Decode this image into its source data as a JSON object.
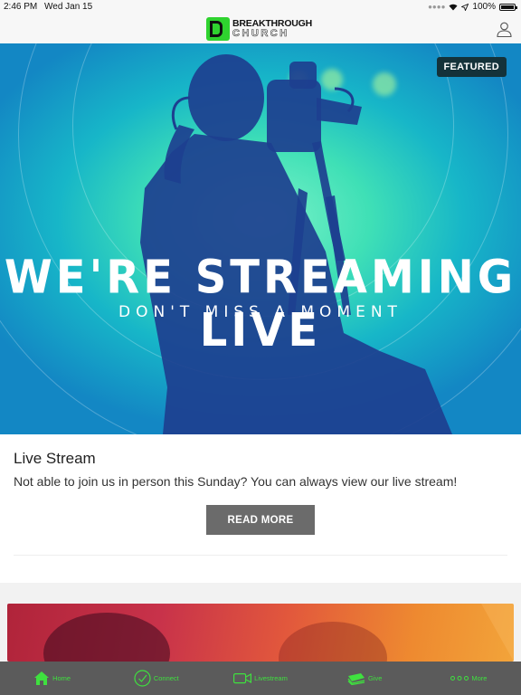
{
  "status": {
    "time": "2:46 PM",
    "date": "Wed Jan 15",
    "battery": "100%"
  },
  "brand": {
    "line1": "BREAKTHROUGH",
    "line2": "CHURCH"
  },
  "hero": {
    "badge": "FEATURED",
    "headline": "WE'RE STREAMING LIVE",
    "subheadline": "DON'T MISS A MOMENT"
  },
  "card": {
    "title": "Live Stream",
    "description": "Not able to join us in person this Sunday? You can always view our live stream!",
    "button_label": "READ MORE"
  },
  "tabs": [
    {
      "label": "Home",
      "icon": "home-icon"
    },
    {
      "label": "Connect",
      "icon": "check-circle-icon"
    },
    {
      "label": "Livestream",
      "icon": "video-camera-icon"
    },
    {
      "label": "Give",
      "icon": "money-icon"
    },
    {
      "label": "More",
      "icon": "more-dots-icon"
    }
  ],
  "colors": {
    "accent": "#3fe03f",
    "tabbar": "#5b5b5b",
    "badge": "#14323a",
    "button": "#6b6b6b"
  }
}
